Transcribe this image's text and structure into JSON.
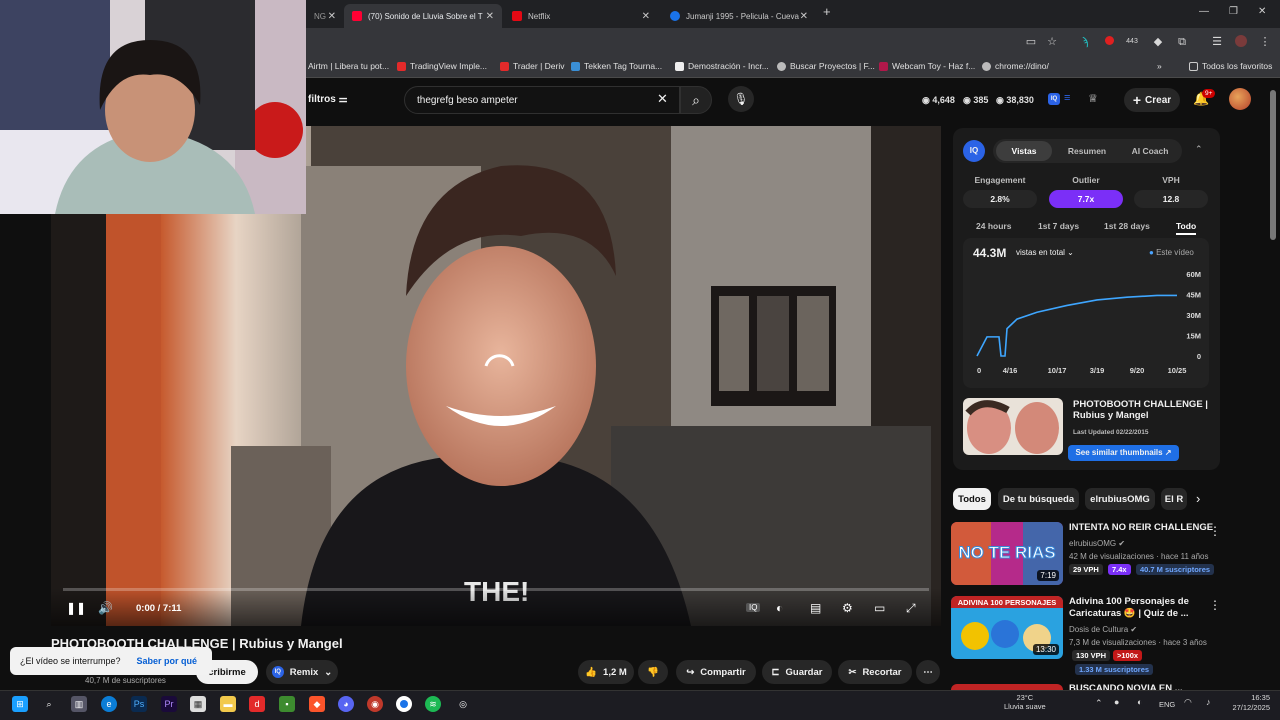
{
  "browser": {
    "tabs": [
      {
        "label": "(70) Sonido de Lluvia Sobre el T",
        "color": "#ff0033"
      },
      {
        "label": "Netflix",
        "color": "#e50914"
      },
      {
        "label": "Jumanji 1995 - Pelicula - Cueva",
        "color": "#1a73e8"
      }
    ],
    "new_tab": "+",
    "window_controls": [
      "—",
      "❐",
      "✕"
    ],
    "bookmarks": [
      "Airtm | Libera tu pot...",
      "TradingView Imple...",
      "Trader | Deriv",
      "Tekken Tag Tourna...",
      "Demostración - Incr...",
      "Buscar Proyectos | F...",
      "Webcam Toy - Haz f...",
      "chrome://dino/"
    ],
    "all_bookmarks": "Todos los favoritos",
    "toolbar_badge": "443"
  },
  "youtube": {
    "filters_label": "filtros",
    "search_value": "thegrefg beso ampeter",
    "stats": {
      "views": "4,648",
      "subs": "385",
      "extra": "38,830"
    },
    "create_label": "Crear",
    "notif_badge": "9+"
  },
  "player": {
    "time": "0:00 / 7:11",
    "progress": 0.0,
    "shirt_text": "THE!"
  },
  "video": {
    "title": "PHOTOBOOTH CHALLENGE | Rubius y Mangel",
    "channel_subs": "40,7 M de suscriptores",
    "subscribe_label": "cribirme",
    "remix_label": "Remix",
    "likes": "1,2 M",
    "share_label": "Compartir",
    "save_label": "Guardar",
    "clip_label": "Recortar"
  },
  "toast": {
    "question": "¿El vídeo se interrumpe?",
    "link": "Saber por qué"
  },
  "iq_panel": {
    "logo": "IQ",
    "tabs": [
      "Vistas",
      "Resumen",
      "AI Coach"
    ],
    "active_tab": "Vistas",
    "metrics": [
      {
        "label": "Engagement",
        "value": "2.8%"
      },
      {
        "label": "Outlier",
        "value": "7.7x"
      },
      {
        "label": "VPH",
        "value": "12.8"
      }
    ],
    "ranges": [
      "24 hours",
      "1st 7 days",
      "1st 28 days",
      "Todo"
    ],
    "active_range": "Todo",
    "total_views": "44.3M",
    "views_mode": "vistas en total",
    "legend": "Este vídeo",
    "related_title": "PHOTOBOOTH CHALLENGE | Rubius y Mangel",
    "last_updated": "Last Updated 02/22/2015",
    "similar_btn": "See similar thumbnails"
  },
  "chart_data": {
    "type": "line",
    "x": [
      "0",
      "4/16",
      "10/17",
      "3/19",
      "9/20",
      "10/25"
    ],
    "y_ticks": [
      "0",
      "15M",
      "30M",
      "45M",
      "60M"
    ],
    "ylim": [
      0,
      60
    ],
    "series": [
      {
        "name": "Este vídeo",
        "points": [
          [
            0,
            0
          ],
          [
            0.05,
            14
          ],
          [
            0.11,
            14
          ],
          [
            0.12,
            0
          ],
          [
            0.14,
            0
          ],
          [
            0.15,
            20
          ],
          [
            0.2,
            27
          ],
          [
            0.3,
            32
          ],
          [
            0.45,
            37
          ],
          [
            0.6,
            41
          ],
          [
            0.75,
            43
          ],
          [
            0.9,
            44.3
          ],
          [
            1,
            44.3
          ]
        ]
      }
    ],
    "x_tick_fractions": [
      0,
      0.165,
      0.4,
      0.6,
      0.8,
      1
    ]
  },
  "chips": [
    "Todos",
    "De tu búsqueda",
    "elrubiusOMG",
    "El R"
  ],
  "recommendations": [
    {
      "title": "INTENTA NO REIR CHALLENGE",
      "channel": "elrubiusOMG",
      "meta": "42 M de visualizaciones · hace 11 años",
      "vph": "29 VPH",
      "outlier": "7.4x",
      "subs": "40.7 M suscriptores",
      "duration": "7:19",
      "thumb_text": "NO TE RIAS"
    },
    {
      "title": "Adivina 100 Personajes de Caricaturas 🤩 | Quiz de ...",
      "channel": "Dosis de Cultura",
      "meta": "7,3 M de visualizaciones · hace 3 años",
      "vph": "130 VPH",
      "outlier": ">100x",
      "subs": "1.33 M suscriptores",
      "duration": "13:30",
      "thumb_text": "ADIVINA 100 PERSONAJES"
    },
    {
      "title": "BUSCANDO NOVIA EN ..."
    }
  ],
  "taskbar": {
    "weather_temp": "23°C",
    "weather_text": "Lluvia suave",
    "lang": "ENG",
    "time": "16:35",
    "date": "27/12/2025"
  }
}
